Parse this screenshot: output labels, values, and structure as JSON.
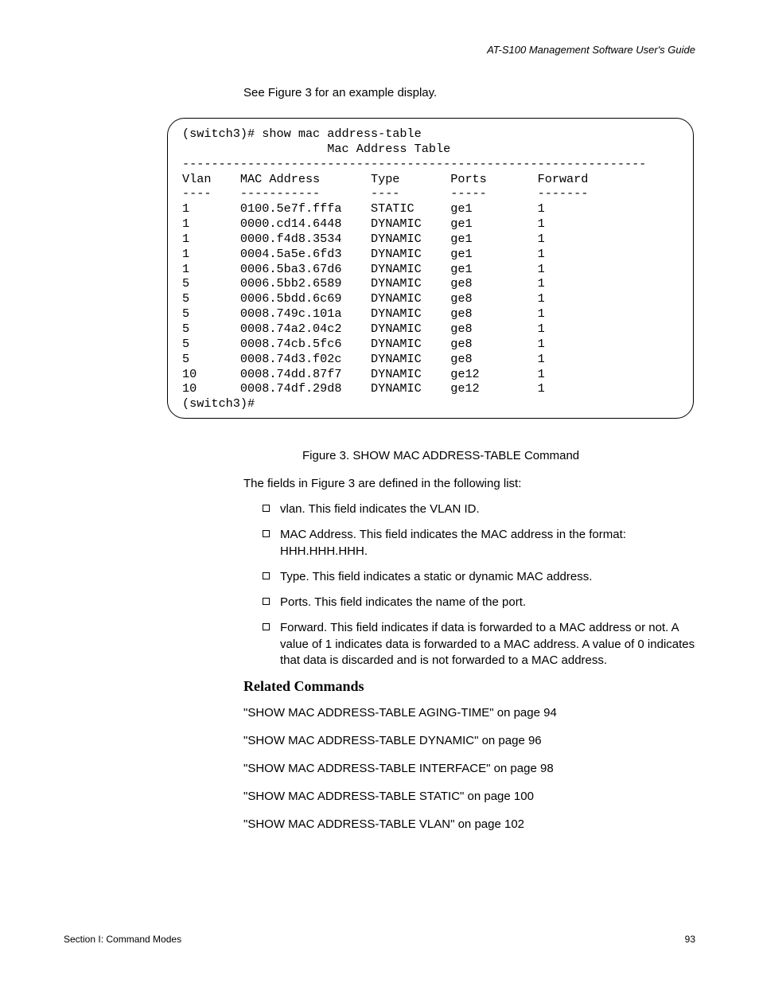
{
  "header": {
    "running_head": "AT-S100 Management Software User's Guide"
  },
  "intro": "See Figure 3 for an example display.",
  "cli": {
    "prompt_cmd": "(switch3)# show mac address-table",
    "title": "                    Mac Address Table",
    "rule": "----------------------------------------------------------------",
    "col_header": "Vlan    MAC Address       Type       Ports       Forward",
    "col_rule": "----    -----------       ----       -----       -------",
    "rows": [
      "1       0100.5e7f.fffa    STATIC     ge1         1",
      "1       0000.cd14.6448    DYNAMIC    ge1         1",
      "1       0000.f4d8.3534    DYNAMIC    ge1         1",
      "1       0004.5a5e.6fd3    DYNAMIC    ge1         1",
      "1       0006.5ba3.67d6    DYNAMIC    ge1         1",
      "5       0006.5bb2.6589    DYNAMIC    ge8         1",
      "5       0006.5bdd.6c69    DYNAMIC    ge8         1",
      "5       0008.749c.101a    DYNAMIC    ge8         1",
      "5       0008.74a2.04c2    DYNAMIC    ge8         1",
      "5       0008.74cb.5fc6    DYNAMIC    ge8         1",
      "5       0008.74d3.f02c    DYNAMIC    ge8         1",
      "10      0008.74dd.87f7    DYNAMIC    ge12        1",
      "10      0008.74df.29d8    DYNAMIC    ge12        1"
    ],
    "prompt_end": "(switch3)#"
  },
  "figure_caption": "Figure 3. SHOW MAC ADDRESS-TABLE Command",
  "fields_intro": "The fields in Figure 3 are defined in the following list:",
  "fields": [
    "vlan. This field indicates the VLAN ID.",
    "MAC Address. This field indicates the MAC address in the format: HHH.HHH.HHH.",
    "Type. This field indicates a static or dynamic MAC address.",
    "Ports. This field indicates the name of the port.",
    "Forward. This field indicates if data is forwarded to a MAC address or not. A value of 1 indicates data is forwarded to a MAC address. A value of 0 indicates that data is discarded and is not forwarded to a MAC address."
  ],
  "related_heading": "Related Commands",
  "related": [
    "\"SHOW MAC ADDRESS-TABLE AGING-TIME\" on page 94",
    "\"SHOW MAC ADDRESS-TABLE DYNAMIC\" on page 96",
    "\"SHOW MAC ADDRESS-TABLE INTERFACE\" on page 98",
    "\"SHOW MAC ADDRESS-TABLE STATIC\" on page 100",
    "\"SHOW MAC ADDRESS-TABLE VLAN\" on page 102"
  ],
  "footer": {
    "left": "Section I: Command Modes",
    "right": "93"
  }
}
